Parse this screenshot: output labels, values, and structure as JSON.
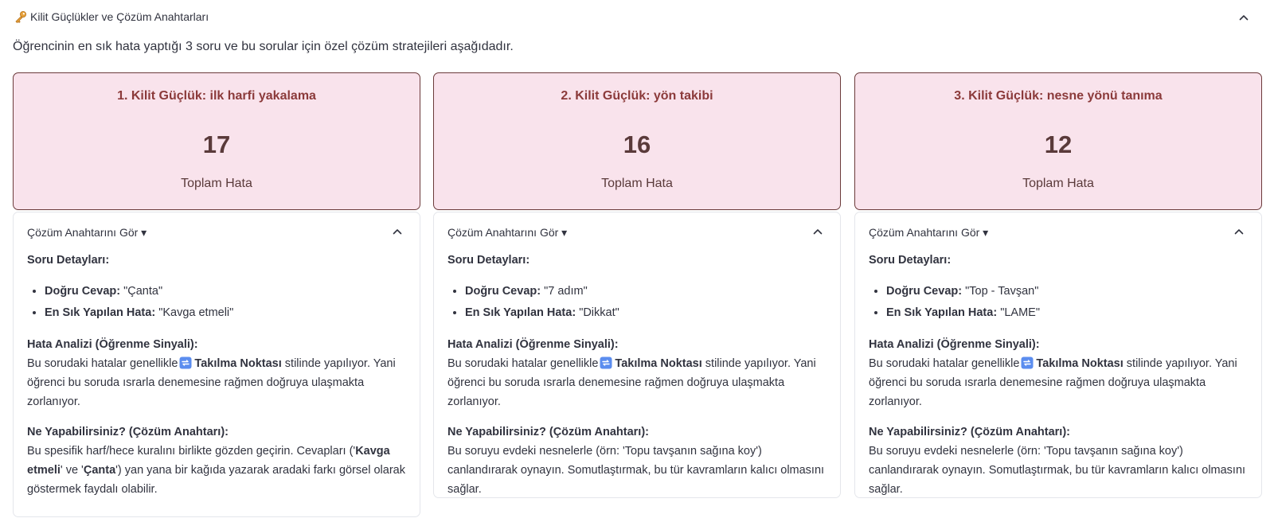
{
  "section": {
    "title": "Kilit Güçlükler ve Çözüm Anahtarları",
    "intro": "Öğrencinin en sık hata yaptığı 3 soru ve bu sorular için özel çözüm stratejileri aşağıdadır."
  },
  "cards": [
    {
      "title": "1. Kilit Güçlük: ilk harfi yakalama",
      "count": "17",
      "count_label": "Toplam Hata",
      "expander_label": "Çözüm Anahtarını Gör ▾",
      "details_title": "Soru Detayları:",
      "correct_label": "Doğru Cevap:",
      "correct_value": "\"Çanta\"",
      "error_label": "En Sık Yapılan Hata:",
      "error_value": "\"Kavga etmeli\"",
      "analysis_title": "Hata Analizi (Öğrenme Sinyali):",
      "analysis_pre": "Bu sorudaki hatalar genellikle",
      "analysis_strong": "Takılma Noktası",
      "analysis_post": "stilinde yapılıyor. Yani öğrenci bu soruda ısrarla denemesine rağmen doğruya ulaşmakta zorlanıyor.",
      "solution_title": "Ne Yapabilirsiniz? (Çözüm Anahtarı):",
      "solution_a": "Bu spesifik harf/hece kuralını birlikte gözden geçirin. Cevapları ('",
      "solution_b": "Kavga etmeli",
      "solution_c": "' ve '",
      "solution_d": "Çanta",
      "solution_e": "') yan yana bir kağıda yazarak aradaki farkı görsel olarak göstermek faydalı olabilir."
    },
    {
      "title": "2. Kilit Güçlük: yön takibi",
      "count": "16",
      "count_label": "Toplam Hata",
      "expander_label": "Çözüm Anahtarını Gör ▾",
      "details_title": "Soru Detayları:",
      "correct_label": "Doğru Cevap:",
      "correct_value": "\"7 adım\"",
      "error_label": "En Sık Yapılan Hata:",
      "error_value": "\"Dikkat\"",
      "analysis_title": "Hata Analizi (Öğrenme Sinyali):",
      "analysis_pre": "Bu sorudaki hatalar genellikle",
      "analysis_strong": "Takılma Noktası",
      "analysis_post": "stilinde yapılıyor. Yani öğrenci bu soruda ısrarla denemesine rağmen doğruya ulaşmakta zorlanıyor.",
      "solution_title": "Ne Yapabilirsiniz? (Çözüm Anahtarı):",
      "solution_text": "Bu soruyu evdeki nesnelerle (örn: 'Topu tavşanın sağına koy') canlandırarak oynayın. Somutlaştırmak, bu tür kavramların kalıcı olmasını sağlar."
    },
    {
      "title": "3. Kilit Güçlük: nesne yönü tanıma",
      "count": "12",
      "count_label": "Toplam Hata",
      "expander_label": "Çözüm Anahtarını Gör ▾",
      "details_title": "Soru Detayları:",
      "correct_label": "Doğru Cevap:",
      "correct_value": "\"Top - Tavşan\"",
      "error_label": "En Sık Yapılan Hata:",
      "error_value": "\"LAME\"",
      "analysis_title": "Hata Analizi (Öğrenme Sinyali):",
      "analysis_pre": "Bu sorudaki hatalar genellikle",
      "analysis_strong": "Takılma Noktası",
      "analysis_post": "stilinde yapılıyor. Yani öğrenci bu soruda ısrarla denemesine rağmen doğruya ulaşmakta zorlanıyor.",
      "solution_title": "Ne Yapabilirsiniz? (Çözüm Anahtarı):",
      "solution_text": "Bu soruyu evdeki nesnelerle (örn: 'Topu tavşanın sağına koy') canlandırarak oynayın. Somutlaştırmak, bu tür kavramların kalıcı olmasını sağlar."
    }
  ],
  "colors": {
    "card_bg": "#f9e3ec",
    "card_border": "#6b3a3a",
    "card_title": "#8b3a3a",
    "text": "#31333f",
    "expander_border": "#e4e6eb",
    "icon_blue": "#5b8def"
  },
  "icons": {
    "section": "key-icon",
    "collapse": "chevron-up-icon",
    "inline": "repeat-icon"
  }
}
